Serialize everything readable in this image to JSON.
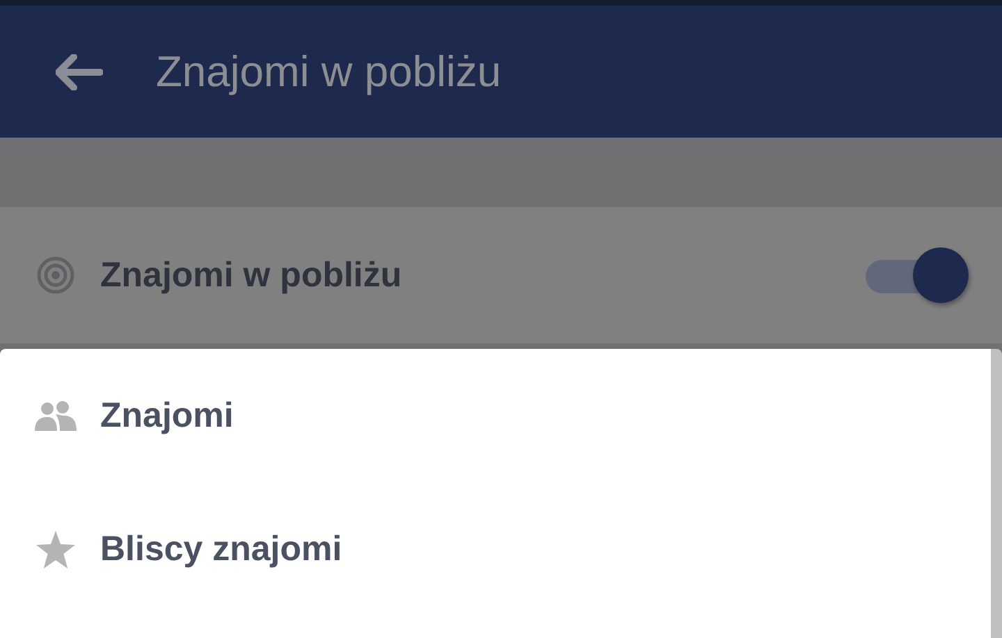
{
  "header": {
    "title": "Znajomi w pobliżu"
  },
  "setting": {
    "label": "Znajomi w pobliżu",
    "on": true
  },
  "menu_options": [
    {
      "kind": "friends",
      "label": "Znajomi"
    },
    {
      "kind": "star",
      "label": "Bliscy znajomi"
    }
  ]
}
